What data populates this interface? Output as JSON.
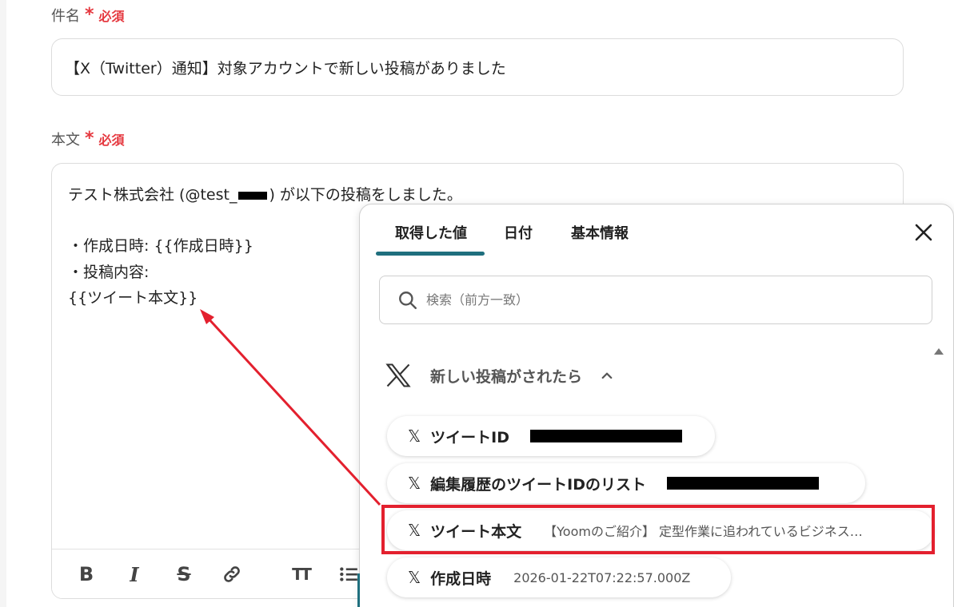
{
  "form": {
    "subject": {
      "label": "件名",
      "required_mark": "*",
      "required_text": "必須",
      "value": "【X（Twitter）通知】対象アカウントで新しい投稿がありました"
    },
    "body": {
      "label": "本文",
      "required_mark": "*",
      "required_text": "必須",
      "line1_prefix": "テスト株式会社 (@test_",
      "line1_suffix": ") が以下の投稿をしました。",
      "line2": "・作成日時: {{作成日時}}",
      "line3": "・投稿内容:",
      "line4": "{{ツイート本文}}"
    },
    "toolbar": {
      "bold": "B",
      "italic": "I",
      "strike": "S",
      "heading": "TT"
    }
  },
  "popup": {
    "tabs": [
      {
        "label": "取得した値",
        "active": true
      },
      {
        "label": "日付",
        "active": false
      },
      {
        "label": "基本情報",
        "active": false
      }
    ],
    "search_placeholder": "検索（前方一致）",
    "group_title": "新しい投稿がされたら",
    "items": [
      {
        "name": "ツイートID",
        "value": "",
        "redacted": true
      },
      {
        "name": "編集履歴のツイートIDのリスト",
        "value": "",
        "redacted": true
      },
      {
        "name": "ツイート本文",
        "value": "【Yoomのご紹介】 定型作業に追われているビジネス…",
        "redacted": false
      },
      {
        "name": "作成日時",
        "value": "2026-01-22T07:22:57.000Z",
        "redacted": false
      }
    ]
  },
  "colors": {
    "accent": "#1f6f7e",
    "required": "#e5383f",
    "annotation": "#e3202e"
  }
}
